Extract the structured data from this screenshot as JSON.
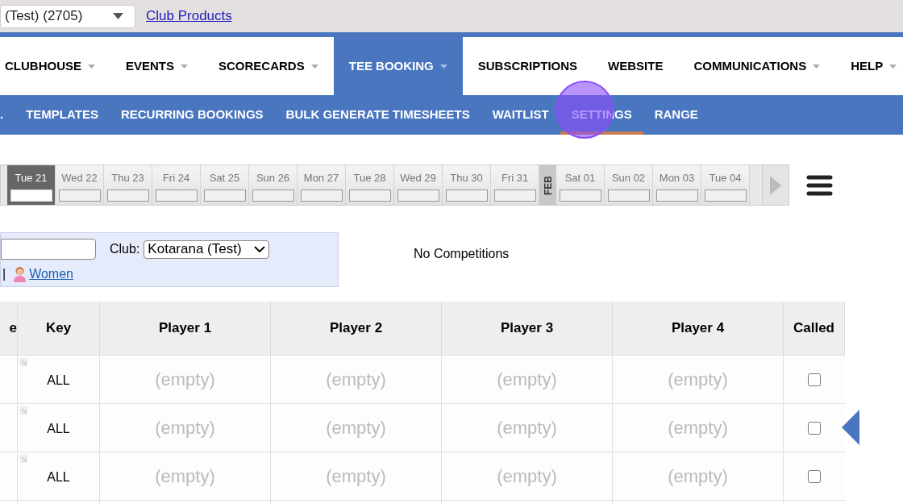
{
  "top_bar": {
    "club_select": {
      "value": "(Test) (2705)"
    },
    "link": "Club Products"
  },
  "main_nav": [
    {
      "label": "CLUBHOUSE",
      "dropdown": true,
      "selected": false
    },
    {
      "label": "EVENTS",
      "dropdown": true,
      "selected": false
    },
    {
      "label": "SCORECARDS",
      "dropdown": true,
      "selected": false
    },
    {
      "label": "TEE BOOKING",
      "dropdown": true,
      "selected": true
    },
    {
      "label": "SUBSCRIPTIONS",
      "dropdown": false,
      "selected": false
    },
    {
      "label": "WEBSITE",
      "dropdown": false,
      "selected": false
    },
    {
      "label": "COMMUNICATIONS",
      "dropdown": true,
      "selected": false
    },
    {
      "label": "HELP",
      "dropdown": true,
      "selected": false
    }
  ],
  "sub_nav": [
    {
      "label": ".",
      "selected": false
    },
    {
      "label": "TEMPLATES",
      "selected": false
    },
    {
      "label": "RECURRING BOOKINGS",
      "selected": false
    },
    {
      "label": "BULK GENERATE TIMESHEETS",
      "selected": false
    },
    {
      "label": "WAITLIST",
      "selected": false
    },
    {
      "label": "SETTINGS",
      "selected": true
    },
    {
      "label": "RANGE",
      "selected": false
    }
  ],
  "dates": [
    {
      "kind": "day",
      "label": "Tue 21",
      "selected": true
    },
    {
      "kind": "day",
      "label": "Wed 22",
      "selected": false
    },
    {
      "kind": "day",
      "label": "Thu 23",
      "selected": false
    },
    {
      "kind": "day",
      "label": "Fri 24",
      "selected": false
    },
    {
      "kind": "day",
      "label": "Sat 25",
      "selected": false
    },
    {
      "kind": "day",
      "label": "Sun 26",
      "selected": false
    },
    {
      "kind": "day",
      "label": "Mon 27",
      "selected": false
    },
    {
      "kind": "day",
      "label": "Tue 28",
      "selected": false
    },
    {
      "kind": "day",
      "label": "Wed 29",
      "selected": false
    },
    {
      "kind": "day",
      "label": "Thu 30",
      "selected": false
    },
    {
      "kind": "day",
      "label": "Fri 31",
      "selected": false
    },
    {
      "kind": "month",
      "label": "FEB"
    },
    {
      "kind": "day",
      "label": "Sat 01",
      "selected": false
    },
    {
      "kind": "day",
      "label": "Sun 02",
      "selected": false
    },
    {
      "kind": "day",
      "label": "Mon 03",
      "selected": false
    },
    {
      "kind": "day",
      "label": "Tue 04",
      "selected": false
    }
  ],
  "filter": {
    "club_label": "Club:",
    "club_select": "Kotarana (Test)",
    "separator": "|",
    "women_link": "Women"
  },
  "competitions": "No Competitions",
  "table": {
    "columns": [
      "e",
      "Key",
      "Player 1",
      "Player 2",
      "Player 3",
      "Player 4",
      "Called"
    ],
    "rows": [
      {
        "key": "ALL",
        "players": [
          "(empty)",
          "(empty)",
          "(empty)",
          "(empty)"
        ],
        "called": false,
        "pointer": false
      },
      {
        "key": "ALL",
        "players": [
          "(empty)",
          "(empty)",
          "(empty)",
          "(empty)"
        ],
        "called": false,
        "pointer": true
      },
      {
        "key": "ALL",
        "players": [
          "(empty)",
          "(empty)",
          "(empty)",
          "(empty)"
        ],
        "called": false,
        "pointer": false
      }
    ]
  }
}
